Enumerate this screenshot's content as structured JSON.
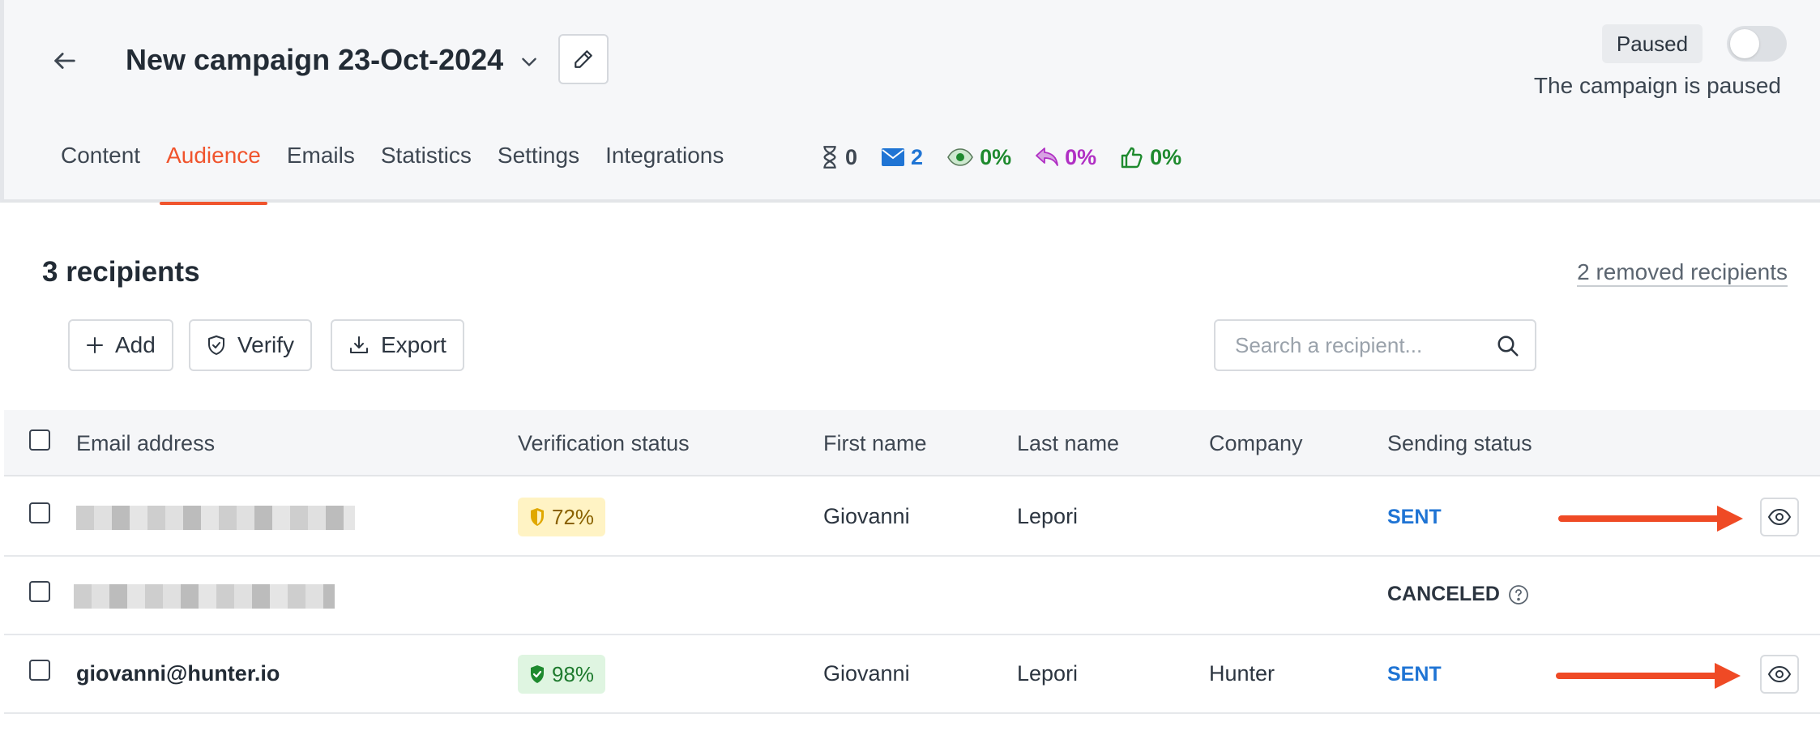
{
  "header": {
    "title": "New campaign 23-Oct-2024",
    "status_badge": "Paused",
    "status_text": "The campaign is paused",
    "toggle_on": false
  },
  "tabs": [
    {
      "label": "Content",
      "active": false
    },
    {
      "label": "Audience",
      "active": true
    },
    {
      "label": "Emails",
      "active": false
    },
    {
      "label": "Statistics",
      "active": false
    },
    {
      "label": "Settings",
      "active": false
    },
    {
      "label": "Integrations",
      "active": false
    }
  ],
  "stats": {
    "pending": {
      "icon": "hourglass-icon",
      "value": "0",
      "color": "#3e4752"
    },
    "sent": {
      "icon": "envelope-icon",
      "value": "2",
      "color": "#1f74d4"
    },
    "opened": {
      "icon": "eye-icon",
      "value": "0%",
      "color": "#1e8a2e"
    },
    "replied": {
      "icon": "reply-icon",
      "value": "0%",
      "color": "#b02fc4"
    },
    "interested": {
      "icon": "thumbs-up-icon",
      "value": "0%",
      "color": "#1e8a2e"
    }
  },
  "recipients": {
    "title": "3 recipients",
    "removed_link": "2 removed recipients"
  },
  "toolbar": {
    "add_label": "Add",
    "verify_label": "Verify",
    "export_label": "Export"
  },
  "search": {
    "placeholder": "Search a recipient...",
    "value": ""
  },
  "table": {
    "columns": [
      "Email address",
      "Verification status",
      "First name",
      "Last name",
      "Company",
      "Sending status"
    ],
    "rows": [
      {
        "email": "",
        "email_redacted": true,
        "verification": "72%",
        "verification_level": "amber",
        "first_name": "Giovanni",
        "last_name": "Lepori",
        "company": "",
        "sending_status": "SENT"
      },
      {
        "email": "",
        "email_redacted": true,
        "verification": "",
        "verification_level": "",
        "first_name": "",
        "last_name": "",
        "company": "",
        "sending_status": "CANCELED"
      },
      {
        "email": "giovanni@hunter.io",
        "email_redacted": false,
        "verification": "98%",
        "verification_level": "green",
        "first_name": "Giovanni",
        "last_name": "Lepori",
        "company": "Hunter",
        "sending_status": "SENT"
      }
    ]
  },
  "colors": {
    "accent": "#f0542d",
    "sent_status": "#1f74d4",
    "annotation_arrow": "#ef4a25"
  }
}
